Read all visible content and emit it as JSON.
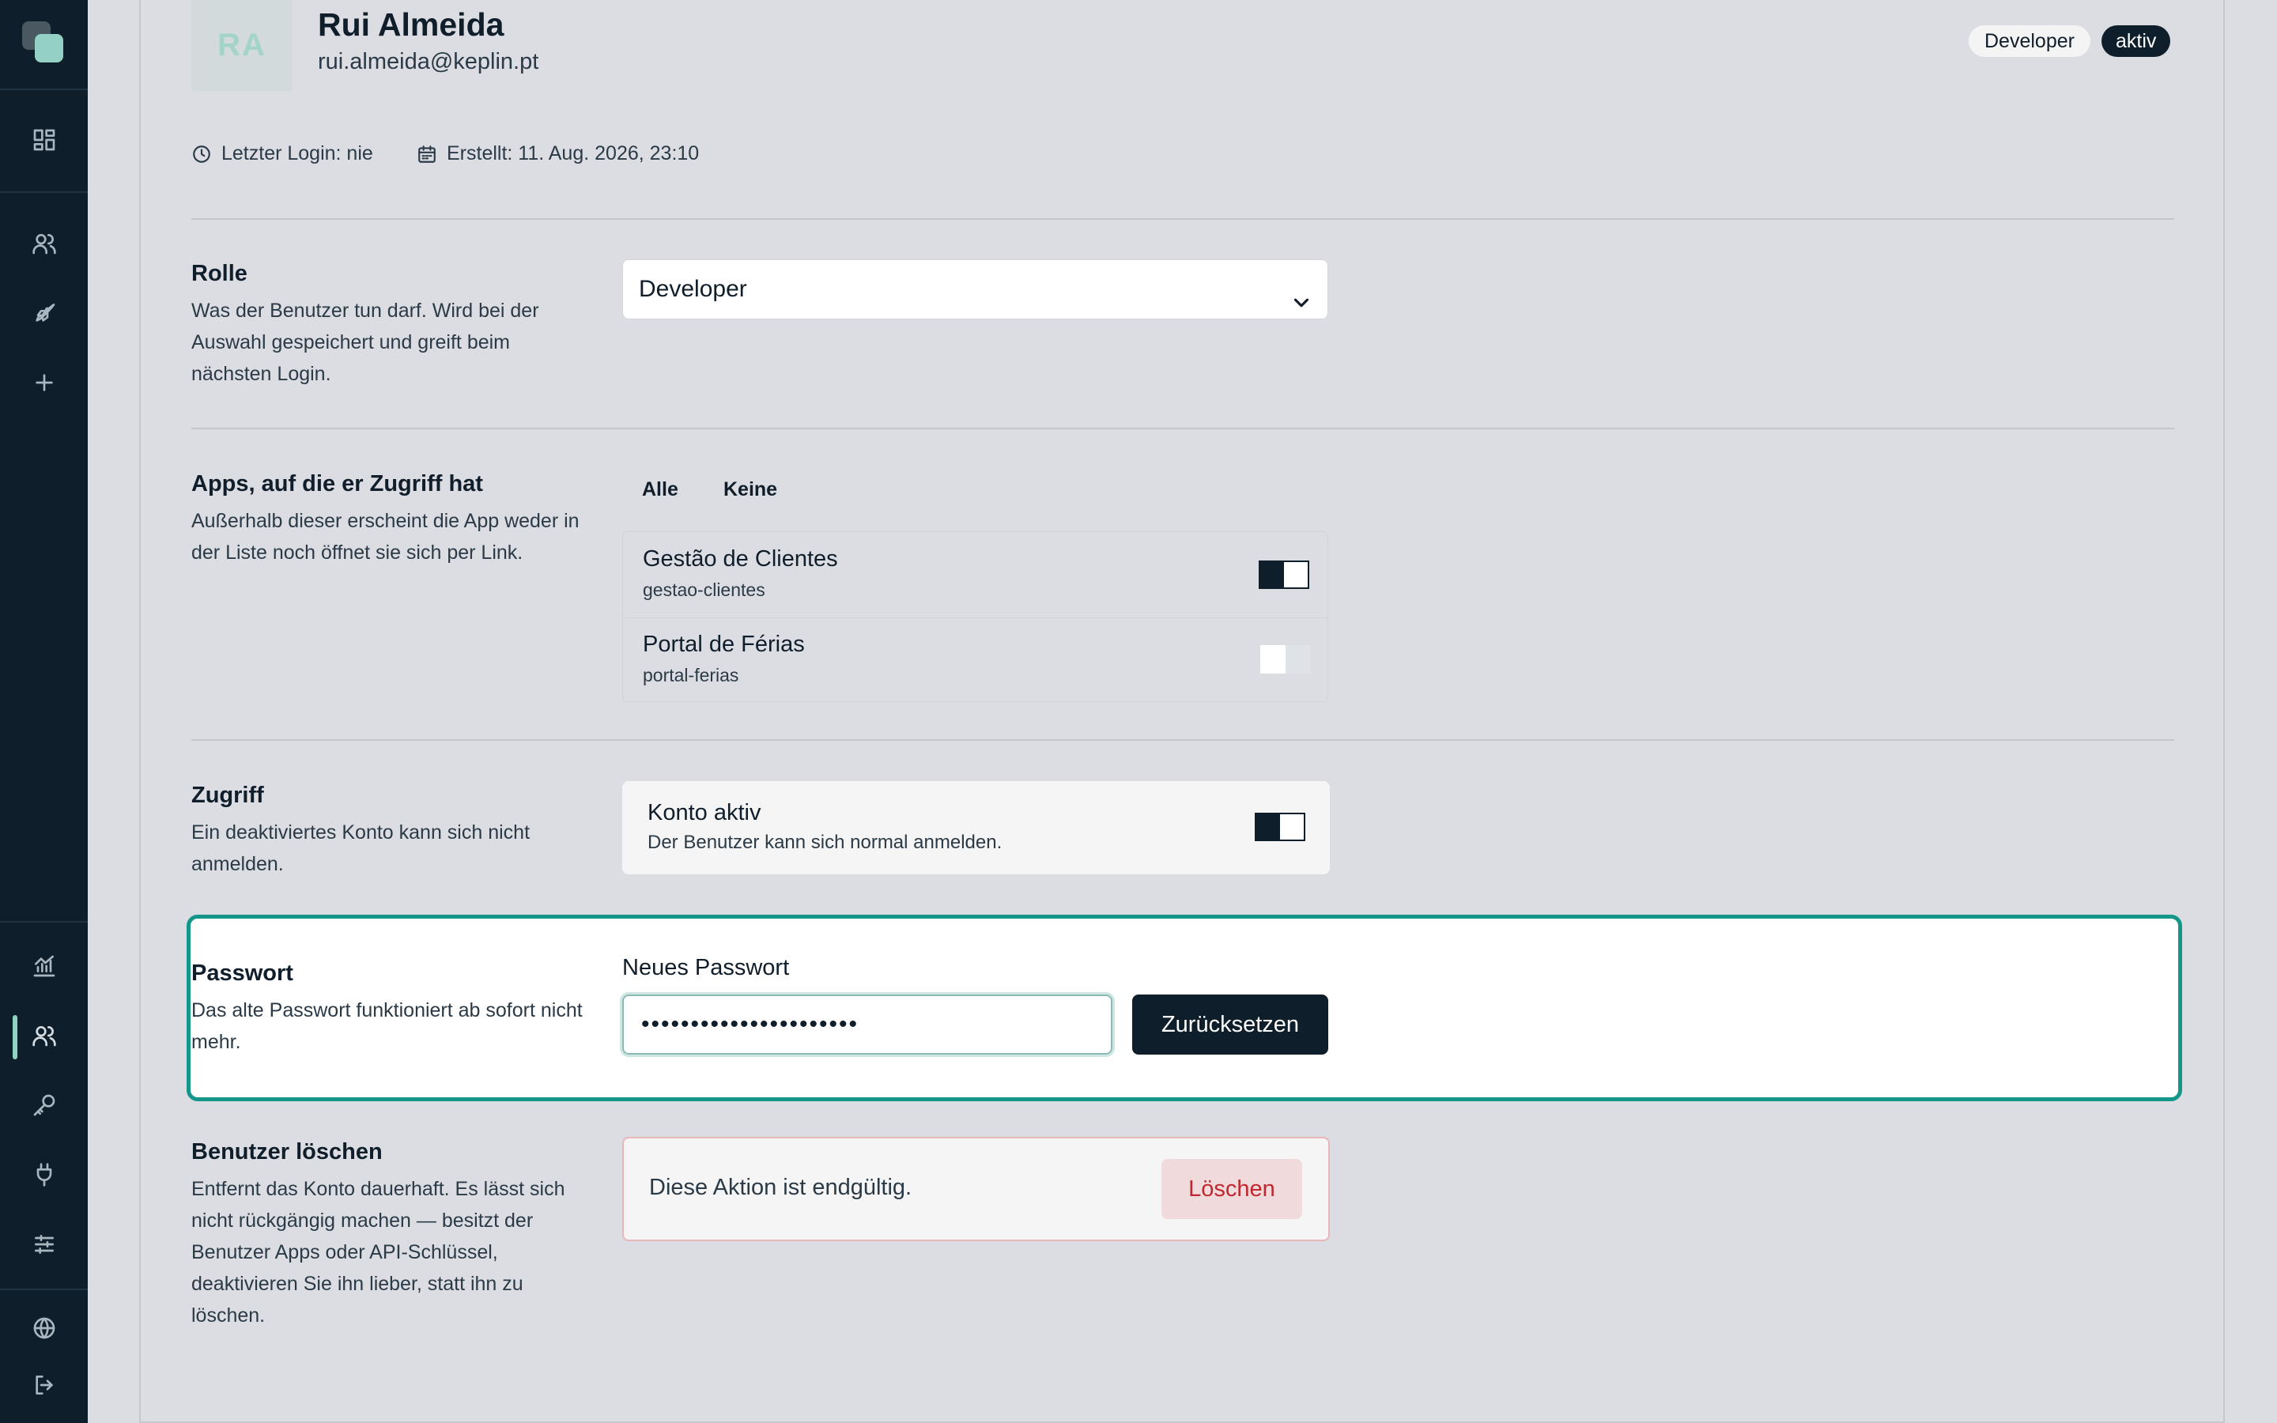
{
  "user": {
    "initials": "RA",
    "name": "Rui Almeida",
    "email": "rui.almeida@keplin.pt",
    "role_badge": "Developer",
    "status_badge": "aktiv",
    "last_login": "Letzter Login: nie",
    "created": "Erstellt: 11. Aug. 2026, 23:10"
  },
  "sidebar": {
    "top_icons": [
      "dashboard-icon",
      "users-icon",
      "rocket-icon",
      "plus-icon"
    ],
    "bottom_icons": [
      "chart-icon",
      "users-icon",
      "key-icon",
      "plug-icon",
      "sliders-icon",
      "globe-icon",
      "logout-icon"
    ],
    "active_item": "users"
  },
  "role": {
    "title": "Rolle",
    "description": "Was der Benutzer tun darf. Wird bei der Auswahl gespeichert und greift beim nächsten Login.",
    "selected": "Developer"
  },
  "apps": {
    "title": "Apps, auf die er Zugriff hat",
    "description": "Außerhalb dieser erscheint die App weder in der Liste noch öffnet sie sich per Link.",
    "select_all": "Alle",
    "select_none": "Keine",
    "items": [
      {
        "name": "Gestão de Clientes",
        "slug": "gestao-clientes",
        "enabled": true
      },
      {
        "name": "Portal de Férias",
        "slug": "portal-ferias",
        "enabled": false
      }
    ]
  },
  "access": {
    "title": "Zugriff",
    "description": "Ein deaktiviertes Konto kann sich nicht anmelden.",
    "card_title": "Konto aktiv",
    "card_sub": "Der Benutzer kann sich normal anmelden.",
    "enabled": true
  },
  "password": {
    "title": "Passwort",
    "description": "Das alte Passwort funktioniert ab sofort nicht mehr.",
    "field_label": "Neues Passwort",
    "value": "••••••••••••••••••••••",
    "reset_label": "Zurücksetzen"
  },
  "delete": {
    "title": "Benutzer löschen",
    "description": "Entfernt das Konto dauerhaft. Es lässt sich nicht rückgängig machen — besitzt der Benutzer Apps oder API-Schlüssel, deaktivieren Sie ihn lieber, statt ihn zu löschen.",
    "warning": "Diese Aktion ist endgültig.",
    "delete_label": "Löschen"
  },
  "colors": {
    "sidebar_bg": "#0e1f2b",
    "accent": "#14978a",
    "danger": "#c0272f"
  }
}
